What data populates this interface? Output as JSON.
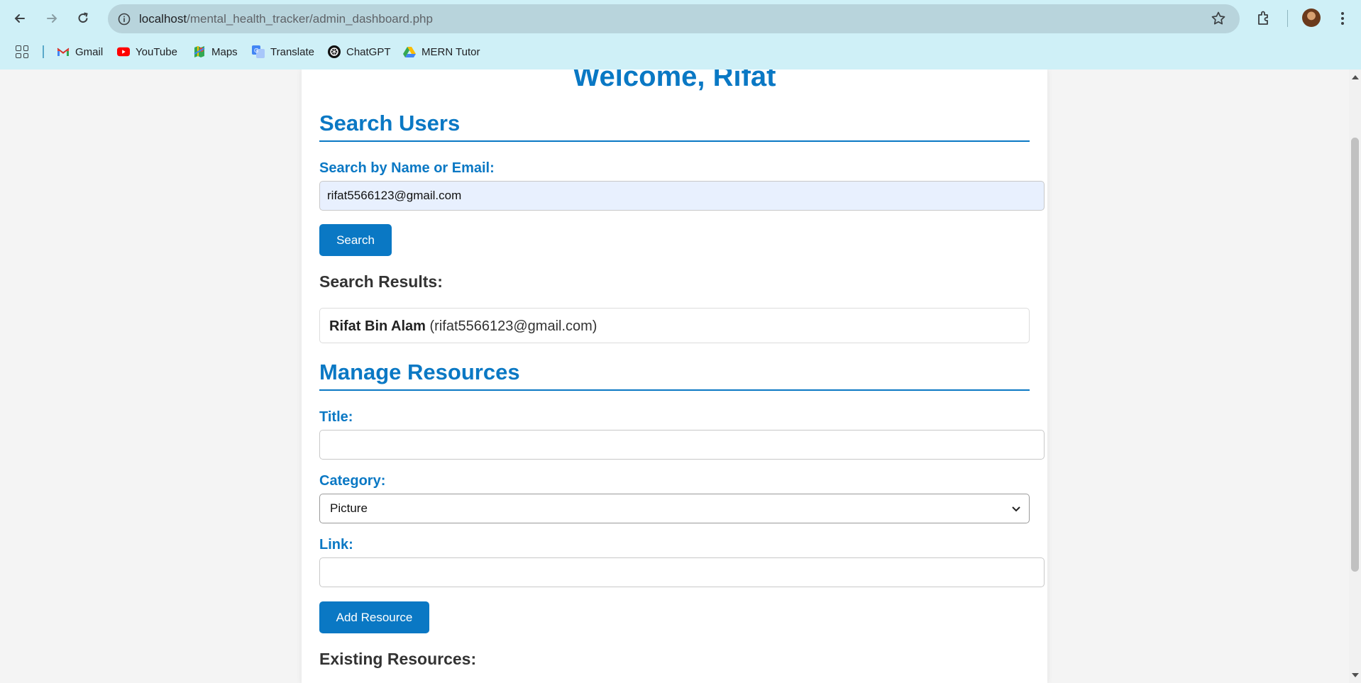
{
  "browser": {
    "url_host": "localhost",
    "url_path": "/mental_health_tracker/admin_dashboard.php",
    "bookmarks": [
      {
        "label": "Gmail",
        "icon": "gmail-icon"
      },
      {
        "label": "YouTube",
        "icon": "youtube-icon"
      },
      {
        "label": "Maps",
        "icon": "maps-icon"
      },
      {
        "label": "Translate",
        "icon": "translate-icon"
      },
      {
        "label": "ChatGPT",
        "icon": "chatgpt-icon"
      },
      {
        "label": "MERN Tutor",
        "icon": "drive-icon"
      }
    ]
  },
  "page": {
    "welcome": "Welcome, Rifat",
    "search": {
      "title": "Search Users",
      "label": "Search by Name or Email:",
      "value": "rifat5566123@gmail.com",
      "button": "Search",
      "results_heading": "Search Results:",
      "results": [
        {
          "name": "Rifat Bin Alam",
          "email": "(rifat5566123@gmail.com)"
        }
      ]
    },
    "resources": {
      "title": "Manage Resources",
      "title_label": "Title:",
      "title_value": "",
      "category_label": "Category:",
      "category_value": "Picture",
      "link_label": "Link:",
      "link_value": "",
      "button": "Add Resource",
      "existing_heading": "Existing Resources:"
    }
  },
  "colors": {
    "accent": "#0a78c4",
    "chrome": "#cff0f7"
  }
}
